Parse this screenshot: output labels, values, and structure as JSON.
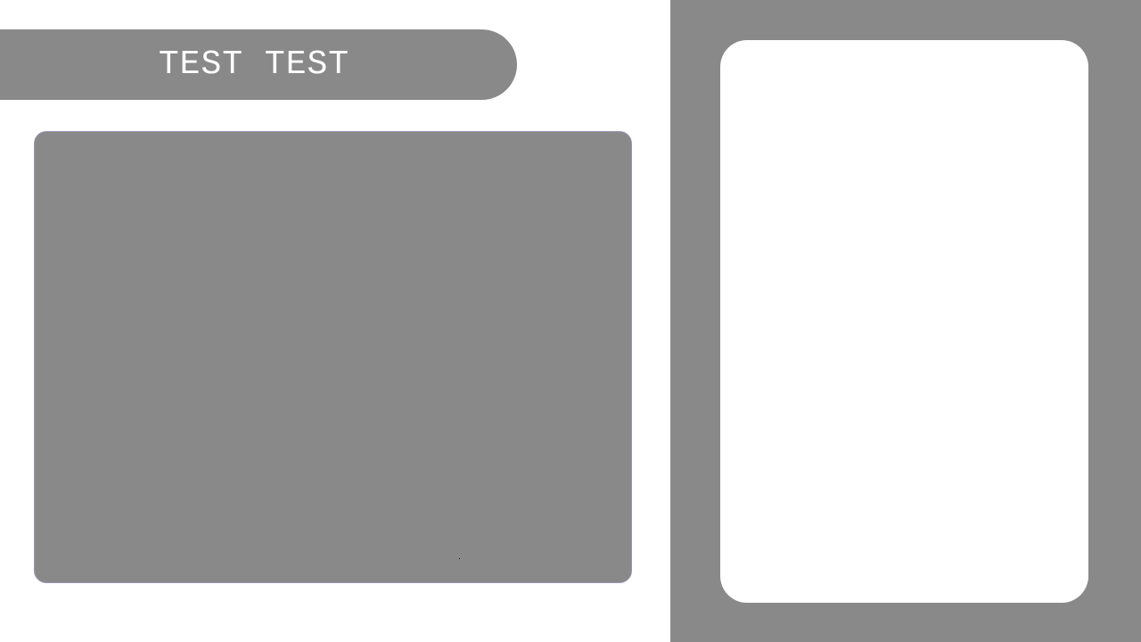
{
  "header": {
    "title": "TEST TEST"
  },
  "colors": {
    "panel": "#898989",
    "background": "#ffffff",
    "text": "#ffffff"
  }
}
